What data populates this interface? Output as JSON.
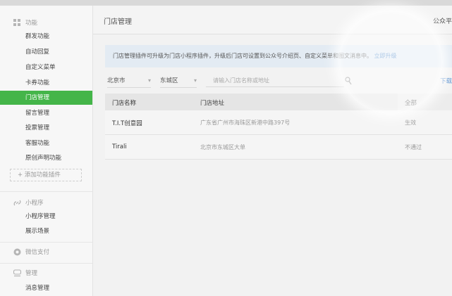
{
  "sidebar": {
    "sections": [
      {
        "label": "功能",
        "icon": "grid-icon"
      },
      {
        "label": "小程序",
        "icon": "link-icon"
      },
      {
        "label": "微信支付",
        "icon": "pay-icon"
      },
      {
        "label": "管理",
        "icon": "manage-icon"
      }
    ],
    "function_items": [
      "群发功能",
      "自动回复",
      "自定义菜单",
      "卡券功能",
      "门店管理",
      "留言管理",
      "投票管理",
      "客服功能",
      "原创声明功能"
    ],
    "add_plugin": "+ 添加功能插件",
    "miniapp_items": [
      "小程序管理",
      "展示场景"
    ],
    "manage_items": [
      "消息管理"
    ]
  },
  "main": {
    "title": "门店管理",
    "public_link": "公众平",
    "notice": "门店管理插件可升级为门店小程序插件，升级后门店可设置到公众号介绍页、自定义菜单和图文消息中。",
    "notice_link": "立即升级",
    "filters": {
      "city": "北京市",
      "district": "东城区",
      "search_placeholder": "请输入门店名称或地址"
    },
    "side_link": "下载",
    "table": {
      "headers": {
        "name": "门店名称",
        "address": "门店地址",
        "status": "全部"
      },
      "rows": [
        {
          "name": "T.I.T创意园",
          "address": "广东省广州市海珠区新港中路397号",
          "status": "生效"
        },
        {
          "name": "Tirali",
          "address": "北京市东城区大单",
          "status": "不通过"
        }
      ]
    }
  },
  "colors": {
    "accent": "#44b549",
    "link": "#4b87cb",
    "notice_bg": "#e3ebf3"
  }
}
